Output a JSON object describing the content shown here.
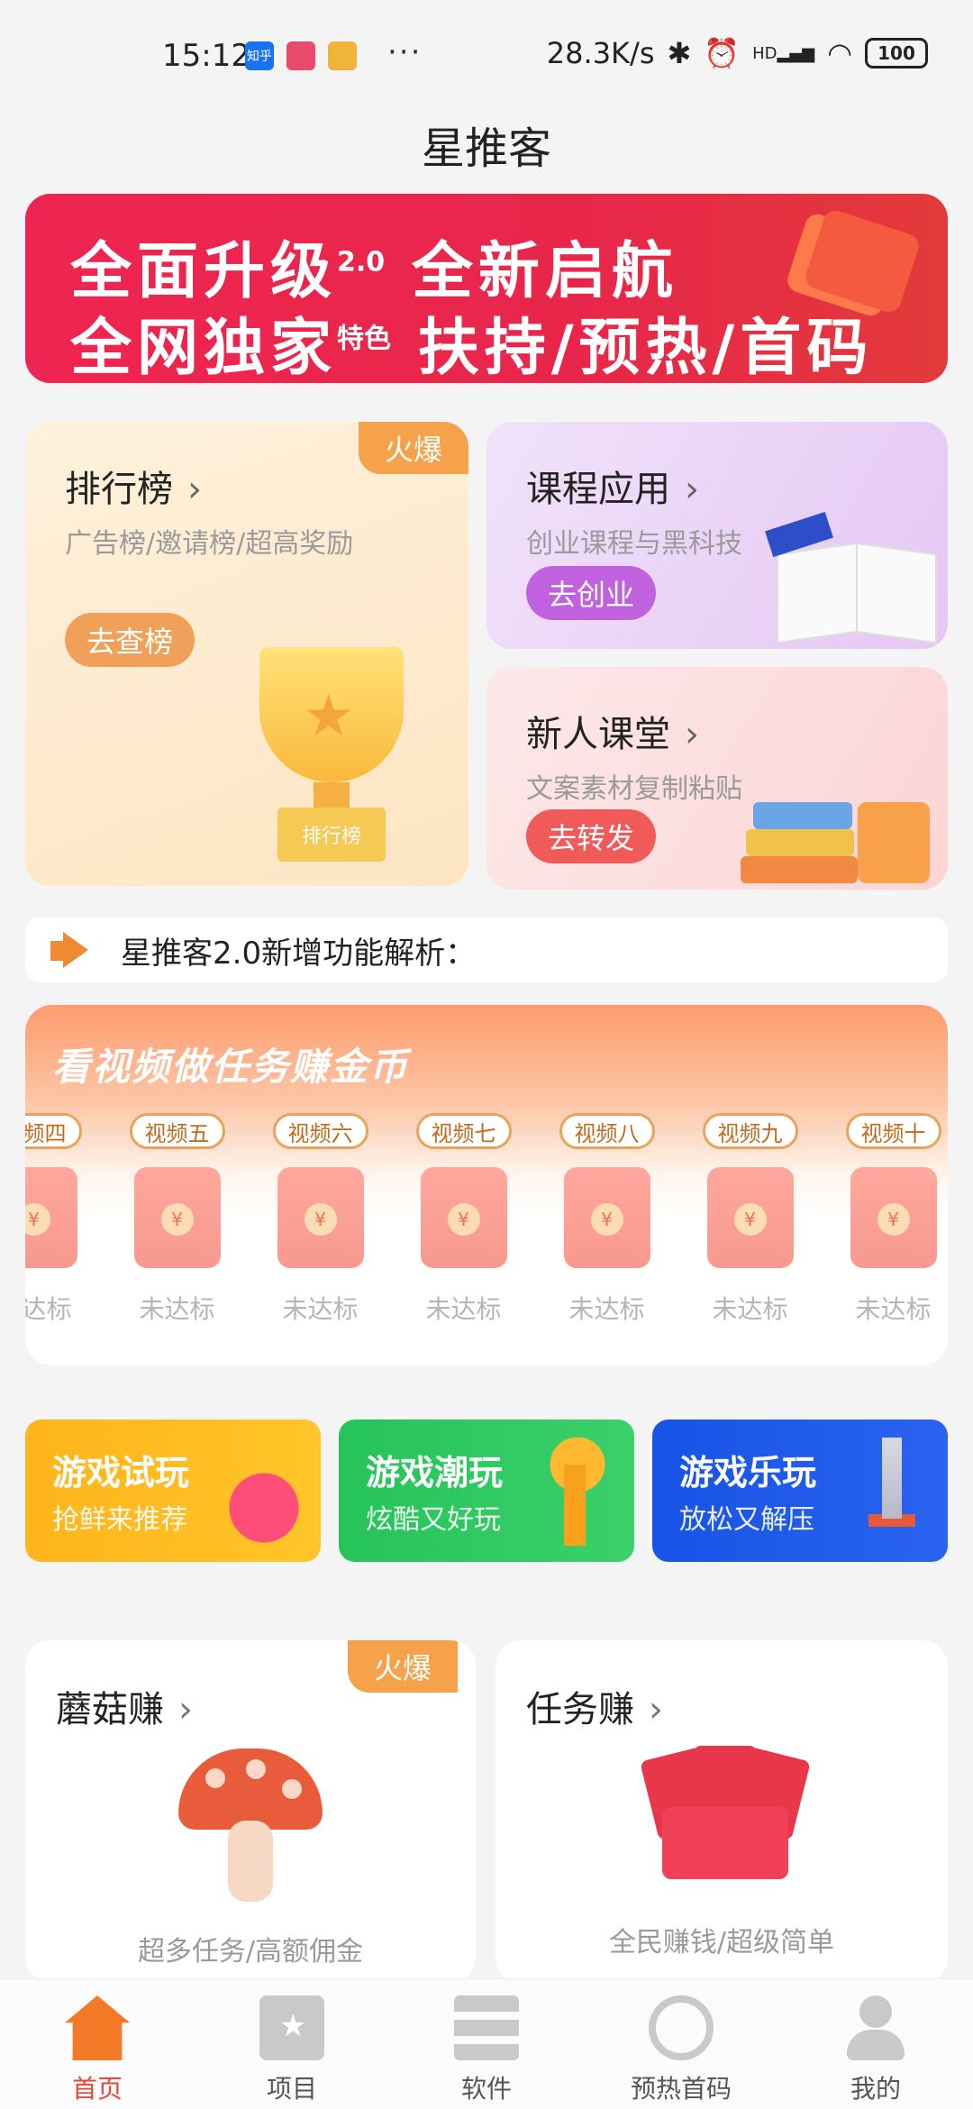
{
  "status_bar": {
    "time": "15:12",
    "apps": [
      "知乎",
      "",
      ""
    ],
    "more": "···",
    "net_speed": "28.3K/s",
    "signal": "HD",
    "battery": "100"
  },
  "page": {
    "title": "星推客"
  },
  "banner": {
    "line1_a": "全面升级",
    "line1_sup": "2.0",
    "line1_b": " 全新启航",
    "line2_a": "全网独家",
    "line2_small": "特色",
    "line2_b": " 扶持/预热/首码"
  },
  "cards": {
    "rank": {
      "title": "排行榜",
      "chev": "›",
      "sub": "广告榜/邀请榜/超高奖励",
      "button": "去查榜",
      "badge": "火爆",
      "trophy_label": "排行榜"
    },
    "course": {
      "title": "课程应用",
      "chev": "›",
      "sub": "创业课程与黑科技",
      "button": "去创业"
    },
    "newbie": {
      "title": "新人课堂",
      "chev": "›",
      "sub": "文案素材复制粘贴",
      "button": "去转发"
    }
  },
  "notice": {
    "text": "星推客2.0新增功能解析："
  },
  "video_tasks": {
    "title": "看视频做任务赚金币",
    "items": [
      {
        "label": "视频四",
        "status": "未达标"
      },
      {
        "label": "视频五",
        "status": "未达标"
      },
      {
        "label": "视频六",
        "status": "未达标"
      },
      {
        "label": "视频七",
        "status": "未达标"
      },
      {
        "label": "视频八",
        "status": "未达标"
      },
      {
        "label": "视频九",
        "status": "未达标"
      },
      {
        "label": "视频十",
        "status": "未达标"
      }
    ],
    "coin": "¥"
  },
  "games": [
    {
      "title": "游戏试玩",
      "sub": "抢鲜来推荐"
    },
    {
      "title": "游戏潮玩",
      "sub": "炫酷又好玩"
    },
    {
      "title": "游戏乐玩",
      "sub": "放松又解压"
    }
  ],
  "bottom_cards": {
    "mushroom": {
      "title": "蘑菇赚",
      "chev": "›",
      "badge": "火爆",
      "sub": "超多任务/高额佣金"
    },
    "task": {
      "title": "任务赚",
      "chev": "›",
      "sub": "全民赚钱/超级简单"
    }
  },
  "nav": {
    "home": "首页",
    "project": "项目",
    "software": "软件",
    "preheat": "预热首码",
    "mine": "我的"
  },
  "colors": {
    "accent": "#e8463a",
    "banner": "#ee2550",
    "badge": "#f5a24a"
  }
}
